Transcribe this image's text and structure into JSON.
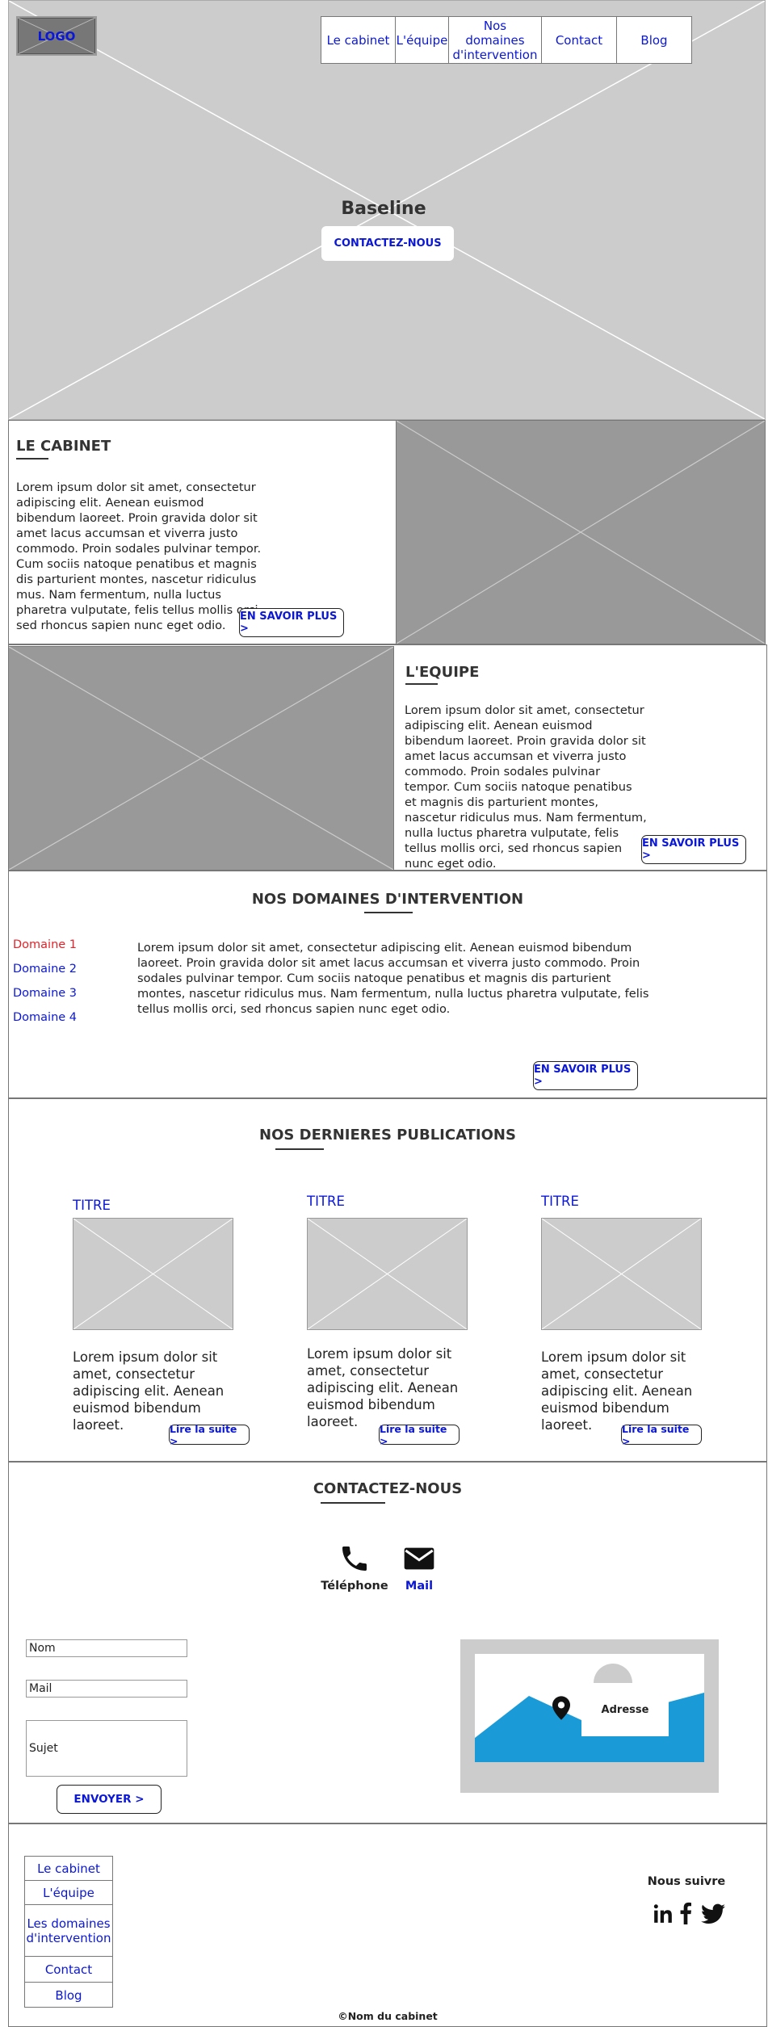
{
  "header": {
    "logo": "LOGO",
    "nav": [
      "Le cabinet",
      "L'équipe",
      "Nos domaines d'intervention",
      "Contact",
      "Blog"
    ],
    "baseline": "Baseline",
    "cta": "CONTACTEZ-NOUS"
  },
  "cabinet": {
    "title": "LE CABINET",
    "text": "Lorem ipsum dolor sit amet, consectetur adipiscing elit. Aenean euismod bibendum laoreet. Proin gravida dolor sit amet lacus accumsan et viverra justo commodo. Proin sodales pulvinar tempor. Cum sociis natoque penatibus et magnis dis parturient montes, nascetur ridiculus mus. Nam fermentum, nulla luctus pharetra vulputate, felis tellus mollis orci, sed rhoncus sapien nunc eget odio.",
    "button": "EN SAVOIR PLUS >"
  },
  "equipe": {
    "title": "L'EQUIPE",
    "text": "Lorem ipsum dolor sit amet, consectetur adipiscing elit. Aenean euismod bibendum laoreet. Proin gravida dolor sit amet lacus accumsan et viverra justo commodo. Proin sodales pulvinar tempor. Cum sociis natoque penatibus et magnis dis parturient montes, nascetur ridiculus mus. Nam fermentum, nulla luctus pharetra vulputate, felis tellus mollis orci, sed rhoncus sapien nunc eget odio.",
    "button": "EN SAVOIR PLUS >"
  },
  "domaines": {
    "title": "NOS DOMAINES D'INTERVENTION",
    "items": [
      "Domaine 1",
      "Domaine 2",
      "Domaine 3",
      "Domaine 4"
    ],
    "text": "Lorem ipsum dolor sit amet, consectetur adipiscing elit. Aenean euismod bibendum laoreet. Proin gravida dolor sit amet lacus accumsan et viverra justo commodo. Proin sodales pulvinar tempor. Cum sociis natoque penatibus et magnis dis parturient montes, nascetur ridiculus mus. Nam fermentum, nulla luctus pharetra vulputate, felis tellus mollis orci, sed rhoncus sapien nunc eget odio.",
    "button": "EN SAVOIR PLUS >"
  },
  "publications": {
    "title": "NOS DERNIERES PUBLICATIONS",
    "cards": [
      {
        "title": "TITRE",
        "text": "Lorem ipsum dolor sit amet, consectetur adipiscing elit. Aenean euismod bibendum laoreet.",
        "button": "Lire la suite >"
      },
      {
        "title": "TITRE",
        "text": "Lorem ipsum dolor sit amet, consectetur adipiscing elit. Aenean euismod bibendum laoreet.",
        "button": "Lire la suite >"
      },
      {
        "title": "TITRE",
        "text": "Lorem ipsum dolor sit amet, consectetur adipiscing elit. Aenean euismod bibendum laoreet.",
        "button": "Lire la suite >"
      }
    ]
  },
  "contact": {
    "title": "CONTACTEZ-NOUS",
    "phone_label": "Téléphone",
    "mail_label": "Mail",
    "fields": {
      "name": "Nom",
      "mail": "Mail",
      "subject": "Sujet"
    },
    "send": "ENVOYER >",
    "map_label": "Adresse"
  },
  "footer": {
    "links": [
      "Le cabinet",
      "L'équipe",
      "Les domaines d'intervention",
      "Contact",
      "Blog"
    ],
    "follow": "Nous suivre",
    "copyright": "©Nom du cabinet"
  },
  "colors": {
    "link": "#0b17d6",
    "active": "#e0242b",
    "placeholder_light": "#cccccc",
    "placeholder_dark": "#999999",
    "map_blue": "#1a9bd7"
  }
}
